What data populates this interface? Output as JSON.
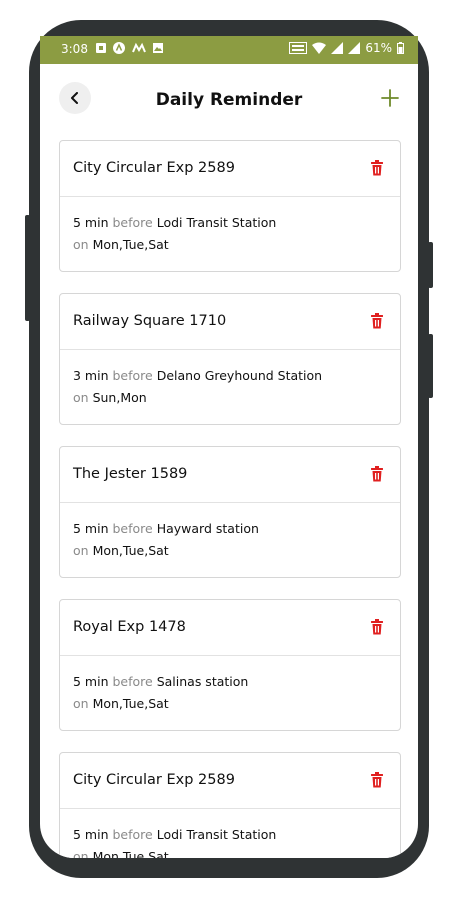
{
  "status_bar": {
    "time": "3:08",
    "battery": "61%",
    "bar_color": "#8c9c42",
    "icons": [
      "sim-card-icon",
      "app-a-icon",
      "app-m-icon",
      "gallery-icon",
      "volte-icon",
      "wifi-icon",
      "signal-icon",
      "signal-icon",
      "battery-icon"
    ]
  },
  "header": {
    "title": "Daily Reminder",
    "back_icon": "back-arrow-icon",
    "add_icon": "plus-icon",
    "accent_color": "#6f8a2a"
  },
  "reminders": [
    {
      "route": "City Circular Exp 2589",
      "minutes": "5 min",
      "before_word": "before",
      "station": "Lodi Transit Station",
      "on_word": "on",
      "days": "Mon,Tue,Sat"
    },
    {
      "route": "Railway Square 1710",
      "minutes": "3 min",
      "before_word": "before",
      "station": "Delano Greyhound Station",
      "on_word": "on",
      "days": "Sun,Mon"
    },
    {
      "route": "The Jester 1589",
      "minutes": "5 min",
      "before_word": "before",
      "station": "Hayward station",
      "on_word": "on",
      "days": "Mon,Tue,Sat"
    },
    {
      "route": "Royal Exp 1478",
      "minutes": "5 min",
      "before_word": "before",
      "station": "Salinas station",
      "on_word": "on",
      "days": "Mon,Tue,Sat"
    },
    {
      "route": "City Circular Exp 2589",
      "minutes": "5 min",
      "before_word": "before",
      "station": "Lodi Transit Station",
      "on_word": "on",
      "days": "Mon,Tue,Sat"
    }
  ],
  "delete_icon": "trash-icon",
  "delete_color": "#e02020"
}
